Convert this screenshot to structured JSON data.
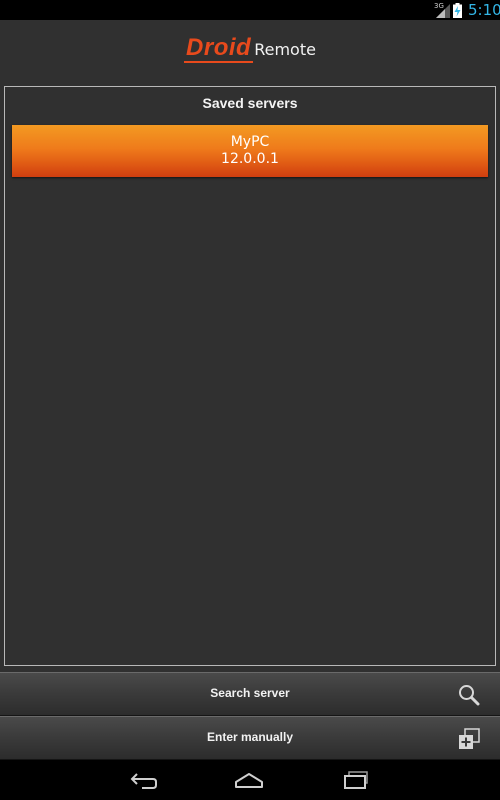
{
  "status_bar": {
    "network": "3G",
    "time": "5:10",
    "time_color": "#33b5e5",
    "icons": [
      "signal-icon",
      "battery-charging-icon"
    ]
  },
  "header": {
    "logo_primary": "Droid",
    "logo_secondary": "Remote",
    "logo_color": "#e84a1c"
  },
  "saved_servers": {
    "title": "Saved servers",
    "items": [
      {
        "name": "MyPC",
        "ip": "12.0.0.1"
      }
    ],
    "item_color": "#ef7b1b"
  },
  "actions": {
    "search": {
      "label": "Search server",
      "icon": "search-icon"
    },
    "manual": {
      "label": "Enter manually",
      "icon": "add-window-icon"
    }
  },
  "nav_bar": {
    "icons": [
      "back-icon",
      "home-icon",
      "recent-apps-icon"
    ]
  }
}
